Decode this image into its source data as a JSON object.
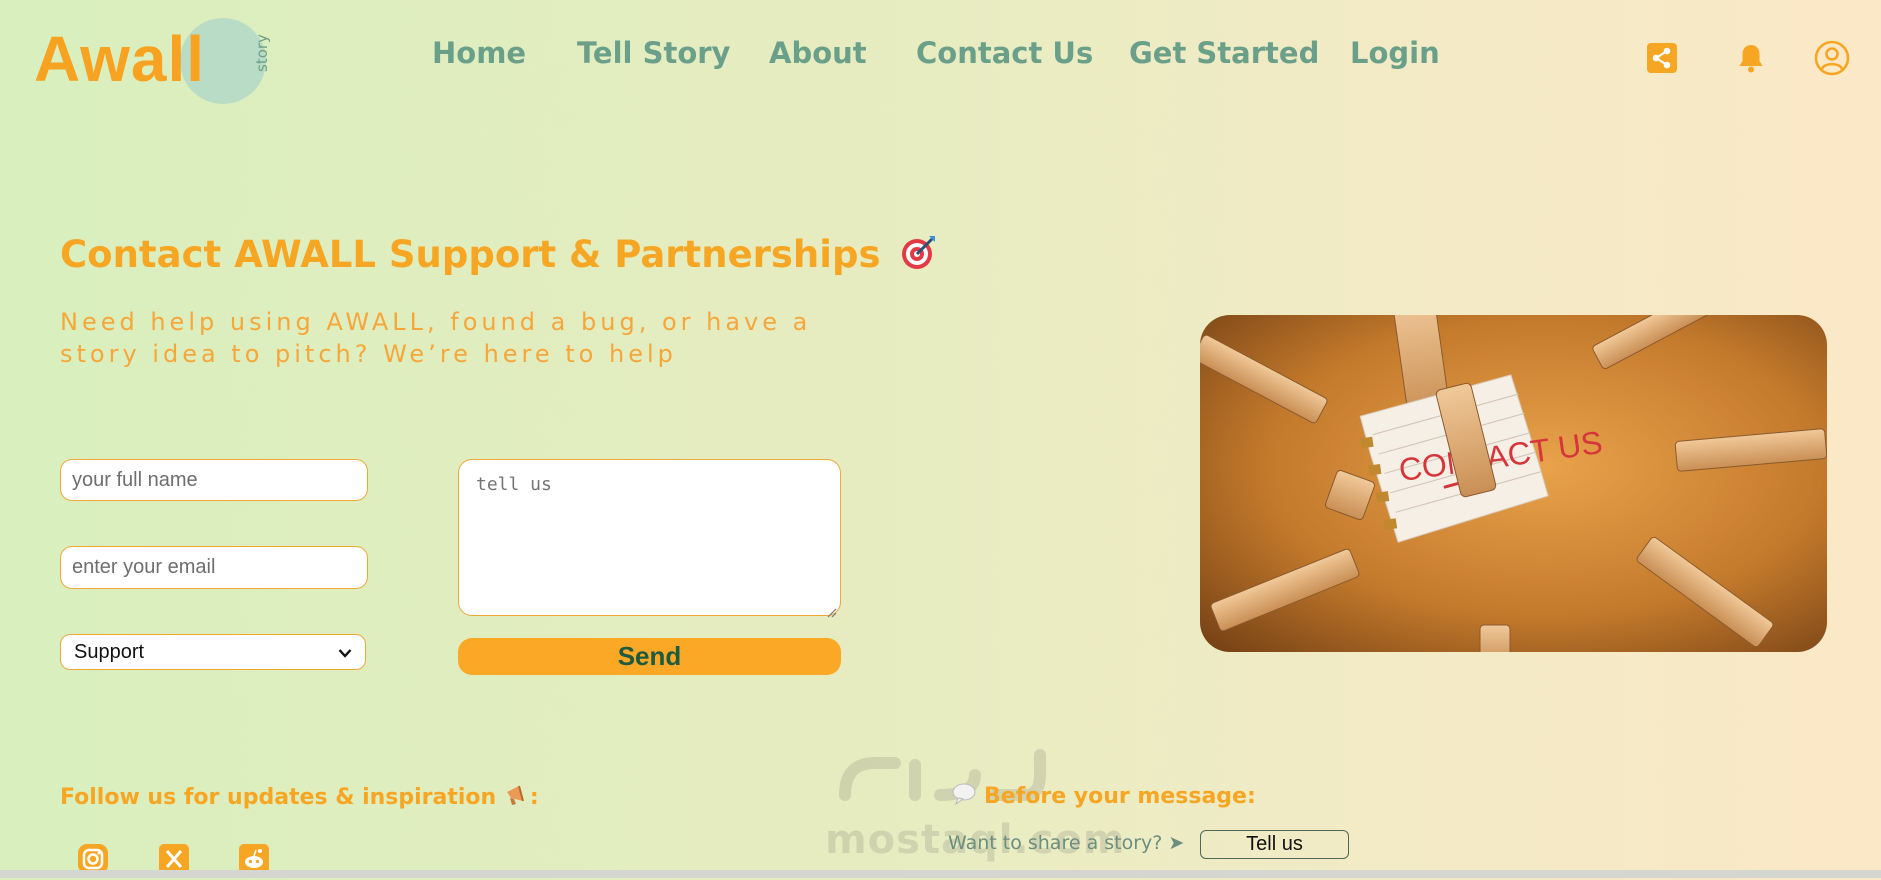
{
  "header": {
    "logo_text": "Awall",
    "logo_sub": "story",
    "nav": [
      "Home",
      "Tell Story",
      "About",
      "Contact Us",
      "Get Started",
      "Login"
    ],
    "icons": [
      "share-icon",
      "bell-icon",
      "user-icon"
    ]
  },
  "hero": {
    "title": "Contact AWALL Support & Partnerships",
    "title_icon": "target-icon",
    "subtitle": "Need help using AWALL, found a bug, or have a story idea to pitch? We’re here to help"
  },
  "form": {
    "name_placeholder": "your full name",
    "email_placeholder": "enter your email",
    "topic_selected": "Support",
    "message_placeholder": "tell us",
    "send_label": "Send"
  },
  "photo": {
    "note_text": "CONTACT US"
  },
  "footer": {
    "follow_label": "Follow us for updates & inspiration",
    "follow_suffix": ":",
    "social_icons": [
      "instagram-icon",
      "x-icon",
      "reddit-icon"
    ],
    "before_label": "Before your message:",
    "share_prompt": "Want to share a story? ➤",
    "tell_us_label": "Tell us"
  },
  "watermark": {
    "text": "mostaql.com"
  },
  "colors": {
    "accent": "#f7a623",
    "nav": "#6a9f8a",
    "send_text": "#1e5a3f"
  }
}
